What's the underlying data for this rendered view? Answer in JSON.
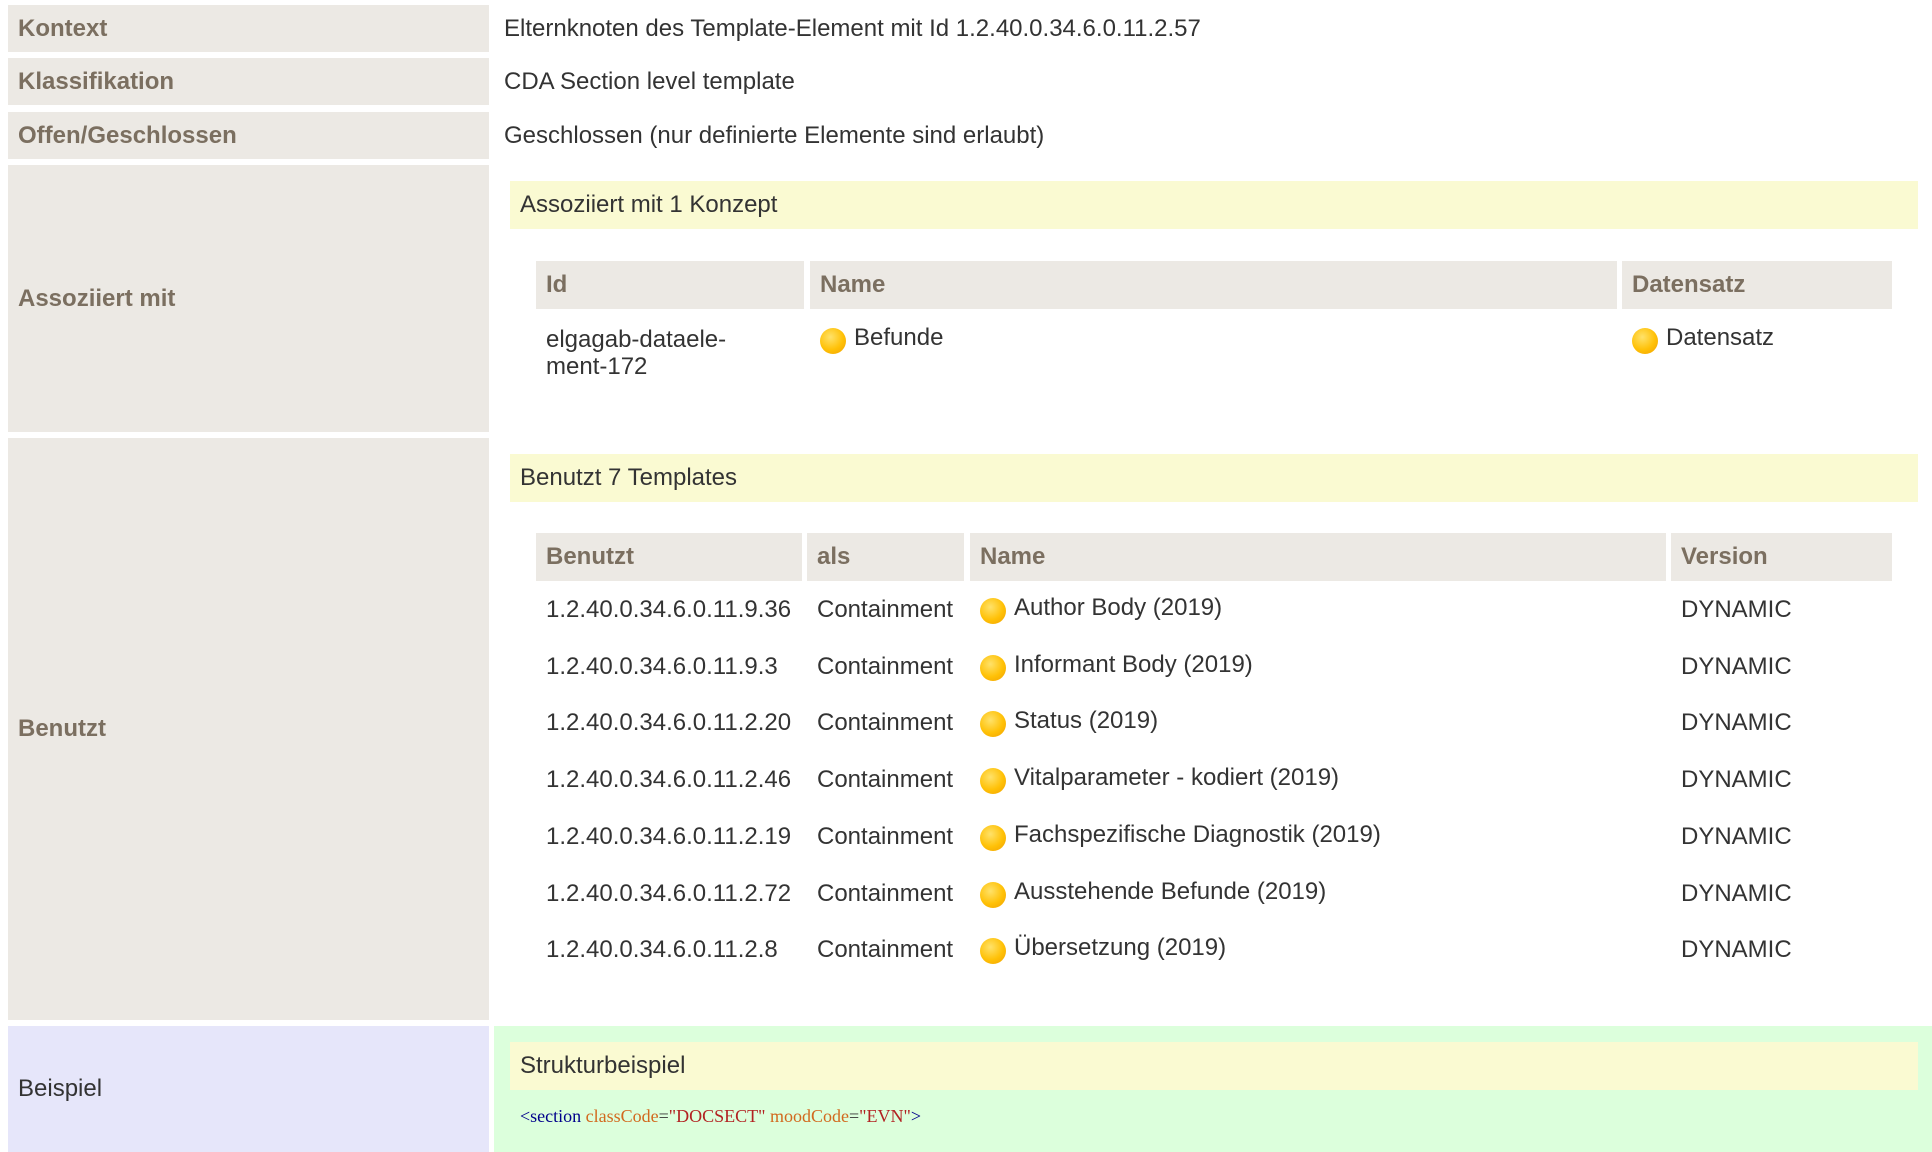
{
  "rows": {
    "kontext": {
      "label": "Kontext",
      "value": "Elternknoten des Template-Element mit Id 1.2.40.0.34.6.0.11.2.57"
    },
    "klassifikation": {
      "label": "Klassifikation",
      "value": "CDA Section level template"
    },
    "offen": {
      "label": "Offen/Geschlossen",
      "value": "Geschlossen (nur definierte Elemente sind erlaubt)"
    },
    "assoziiert": {
      "label": "Assoziiert mit",
      "box_title": "Assoziiert mit 1 Konzept",
      "headers": [
        "Id",
        "Name",
        "Datensatz"
      ],
      "row": {
        "id_line1": "elgagab-dataele-",
        "id_line2": "ment-172",
        "name": "Befunde",
        "datensatz": "Datensatz"
      }
    },
    "benutzt": {
      "label": "Benutzt",
      "box_title": "Benutzt 7 Templates",
      "headers": [
        "Benutzt",
        "als",
        "Name",
        "Version"
      ],
      "items": [
        {
          "id": "1.2.40.0.34.6.0.11.9.36",
          "als": "Containment",
          "name": "Author Body (2019)",
          "version": "DYNAMIC"
        },
        {
          "id": "1.2.40.0.34.6.0.11.9.3",
          "als": "Containment",
          "name": "Informant Body (2019)",
          "version": "DYNAMIC"
        },
        {
          "id": "1.2.40.0.34.6.0.11.2.20",
          "als": "Containment",
          "name": "Status (2019)",
          "version": "DYNAMIC"
        },
        {
          "id": "1.2.40.0.34.6.0.11.2.46",
          "als": "Containment",
          "name": "Vitalparameter - kodiert (2019)",
          "version": "DYNAMIC"
        },
        {
          "id": "1.2.40.0.34.6.0.11.2.19",
          "als": "Containment",
          "name": "Fachspezifische Diagnostik (2019)",
          "version": "DYNAMIC"
        },
        {
          "id": "1.2.40.0.34.6.0.11.2.72",
          "als": "Containment",
          "name": "Ausstehende Befunde (2019)",
          "version": "DYNAMIC"
        },
        {
          "id": "1.2.40.0.34.6.0.11.2.8",
          "als": "Containment",
          "name": "Übersetzung (2019)",
          "version": "DYNAMIC"
        }
      ]
    },
    "beispiel": {
      "label": "Beispiel",
      "box_title": "Strukturbeispiel",
      "code": {
        "open": "<",
        "tag": "section",
        "attr1": "classCode",
        "eq1": "=",
        "val1": "\"DOCSECT\"",
        "attr2": "moodCode",
        "eq2": "=",
        "val2": "\"EVN\"",
        "close": ">"
      }
    }
  },
  "colors": {
    "label_bg": "#ece9e4",
    "label_text": "#7b6f60",
    "box_head_bg": "#fafad2",
    "example_label_bg": "#e6e6fa",
    "example_bg": "#dcffdc",
    "concept_dot": "#ffc107"
  },
  "icons": [
    "concept-dot-icon"
  ]
}
